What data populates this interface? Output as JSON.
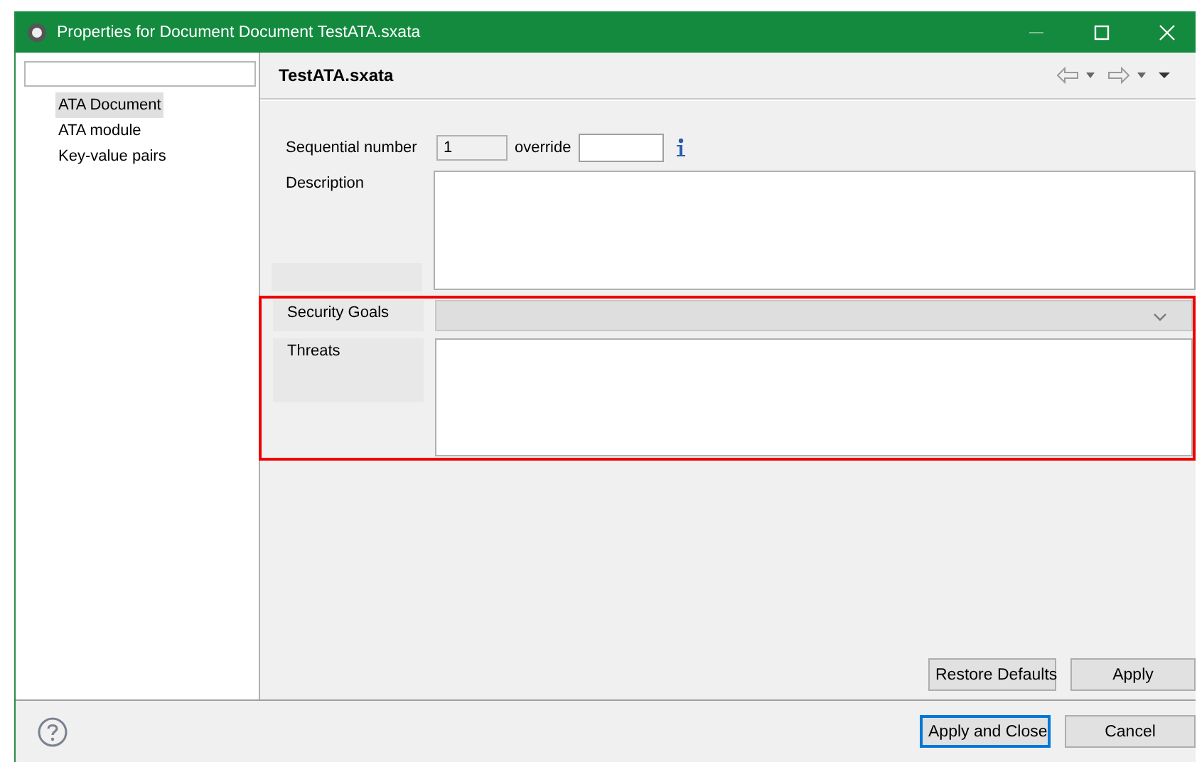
{
  "window": {
    "title": "Properties for Document Document TestATA.sxata"
  },
  "sidebar": {
    "items": [
      {
        "label": "ATA Document",
        "selected": true
      },
      {
        "label": "ATA module",
        "selected": false
      },
      {
        "label": "Key-value pairs",
        "selected": false
      }
    ]
  },
  "page": {
    "title": "TestATA.sxata",
    "sequential": {
      "label": "Sequential number",
      "value": "1",
      "override_label": "override"
    },
    "description": {
      "label": "Description"
    },
    "security_goals": {
      "label": "Security Goals",
      "disabled": true
    },
    "threats": {
      "label": "Threats"
    },
    "highlighted": true,
    "buttons": [
      "Restore Defaults",
      "Apply"
    ]
  },
  "footer": {
    "buttons": [
      {
        "label": "Apply and Close",
        "default": true
      },
      {
        "label": "Cancel",
        "default": false
      }
    ]
  }
}
